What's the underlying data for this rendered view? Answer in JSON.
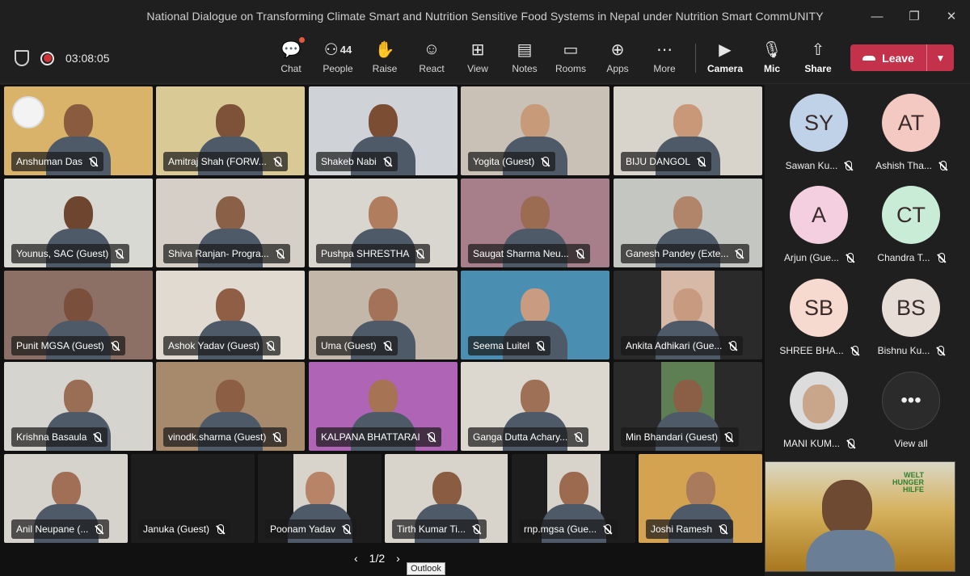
{
  "window": {
    "title": "National Dialogue on Transforming Climate Smart and Nutrition Sensitive Food Systems in Nepal under Nutrition Smart CommUNITY",
    "minimize": "—",
    "maximize": "❐",
    "close": "✕"
  },
  "meeting": {
    "timer": "03:08:05"
  },
  "toolbar": {
    "buttons": [
      {
        "label": "Chat",
        "icon": "chat-icon"
      },
      {
        "label": "People",
        "icon": "people-icon",
        "count": "44"
      },
      {
        "label": "Raise",
        "icon": "hand-icon"
      },
      {
        "label": "React",
        "icon": "smiley-icon"
      },
      {
        "label": "View",
        "icon": "grid-icon"
      },
      {
        "label": "Notes",
        "icon": "notes-icon"
      },
      {
        "label": "Rooms",
        "icon": "rooms-icon"
      },
      {
        "label": "Apps",
        "icon": "apps-icon"
      },
      {
        "label": "More",
        "icon": "more-icon"
      },
      {
        "label": "Camera",
        "icon": "camera-icon"
      },
      {
        "label": "Mic",
        "icon": "mic-icon"
      },
      {
        "label": "Share",
        "icon": "share-icon"
      }
    ],
    "leave_label": "Leave"
  },
  "video_tiles": [
    {
      "name": "Anshuman Das",
      "bg": "#d9b36a",
      "skin": "#8a5b3e"
    },
    {
      "name": "Amitraj Shah (FORW...",
      "bg": "#d8c995",
      "skin": "#7d5238"
    },
    {
      "name": "Shakeb Nabi",
      "bg": "#cfd2d6",
      "skin": "#7b4e33"
    },
    {
      "name": "Yogita (Guest)",
      "bg": "#c9c1b6",
      "skin": "#c79a7a"
    },
    {
      "name": "BIJU DANGOL",
      "bg": "#d8d3cb",
      "skin": "#c89879"
    },
    {
      "name": "Younus, SAC (Guest)",
      "bg": "#d9d9d3",
      "skin": "#6e4630"
    },
    {
      "name": "Shiva Ranjan- Progra...",
      "bg": "#d6cfc7",
      "skin": "#8a6047"
    },
    {
      "name": "Pushpa SHRESTHA",
      "bg": "#d9d6cf",
      "skin": "#b07e5f"
    },
    {
      "name": "Saugat Sharma Neu...",
      "bg": "#a77f8b",
      "skin": "#9b6b52"
    },
    {
      "name": "Ganesh Pandey (Exte...",
      "bg": "#c4c6c2",
      "skin": "#b0856a"
    },
    {
      "name": "Punit MGSA (Guest)",
      "bg": "#8c6f65",
      "skin": "#7a4f3c"
    },
    {
      "name": "Ashok Yadav (Guest)",
      "bg": "#e0dad0",
      "skin": "#8f5e45"
    },
    {
      "name": "Uma (Guest)",
      "bg": "#c3b7a9",
      "skin": "#a47258"
    },
    {
      "name": "Seema Luitel",
      "bg": "#4a8fb1",
      "skin": "#c99b80"
    },
    {
      "name": "Ankita Adhikari (Gue...",
      "bg": "#2a2a2a",
      "skin": "#c89b80"
    },
    {
      "name": "Krishna Basaula",
      "bg": "#d6d4cf",
      "skin": "#9a6d55"
    },
    {
      "name": "vinodk.sharma (Guest)",
      "bg": "#a78a6c",
      "skin": "#8c5e44"
    },
    {
      "name": "KALPANA BHATTARAI",
      "bg": "#b064b6",
      "skin": "#a67355"
    },
    {
      "name": "Ganga Dutta Achary...",
      "bg": "#dcd8d0",
      "skin": "#9e7055"
    },
    {
      "name": "Min Bhandari (Guest)",
      "bg": "#2a2a2a",
      "skin": "#8b5f45"
    },
    {
      "name": "Anil Neupane (...",
      "bg": "#d6d3cd",
      "skin": "#a06f55"
    },
    {
      "name": "Januka (Guest)",
      "bg": "#1d1d1d",
      "skin": ""
    },
    {
      "name": "Poonam Yadav",
      "bg": "#1d1d1d",
      "skin": "#b88468"
    },
    {
      "name": "Tirth Kumar Ti...",
      "bg": "#1d1d1d",
      "skin": "#8a5d43"
    },
    {
      "name": "rnp.mgsa (Gue...",
      "bg": "#1d1d1d",
      "skin": "#9b6a4f"
    },
    {
      "name": "Joshi Ramesh",
      "bg": "#d3a352",
      "skin": "#a97b5c"
    }
  ],
  "pager": {
    "text": "1/2",
    "prev": "‹",
    "next": "›"
  },
  "tooltip": "Outlook",
  "people_panel": [
    {
      "initials": "SY",
      "name": "Sawan Ku...",
      "color": "#bfd2e8"
    },
    {
      "initials": "AT",
      "name": "Ashish Tha...",
      "color": "#f4c9c2"
    },
    {
      "initials": "A",
      "name": "Arjun (Gue...",
      "color": "#f3cfe0"
    },
    {
      "initials": "CT",
      "name": "Chandra T...",
      "color": "#c9ecd7"
    },
    {
      "initials": "SB",
      "name": "SHREE BHA...",
      "color": "#f6d9cf"
    },
    {
      "initials": "BS",
      "name": "Bishnu Ku...",
      "color": "#e7ddd7"
    },
    {
      "initials": "",
      "name": "MANI KUM...",
      "color": "#dcdcdc"
    }
  ],
  "view_all": {
    "label": "View all",
    "glyph": "•••"
  },
  "self_view": {
    "logo_lines": [
      "WELT",
      "HUNGER",
      "HILFE"
    ]
  },
  "colors": {
    "leave": "#c4314b",
    "accent": "#e35a3f"
  }
}
